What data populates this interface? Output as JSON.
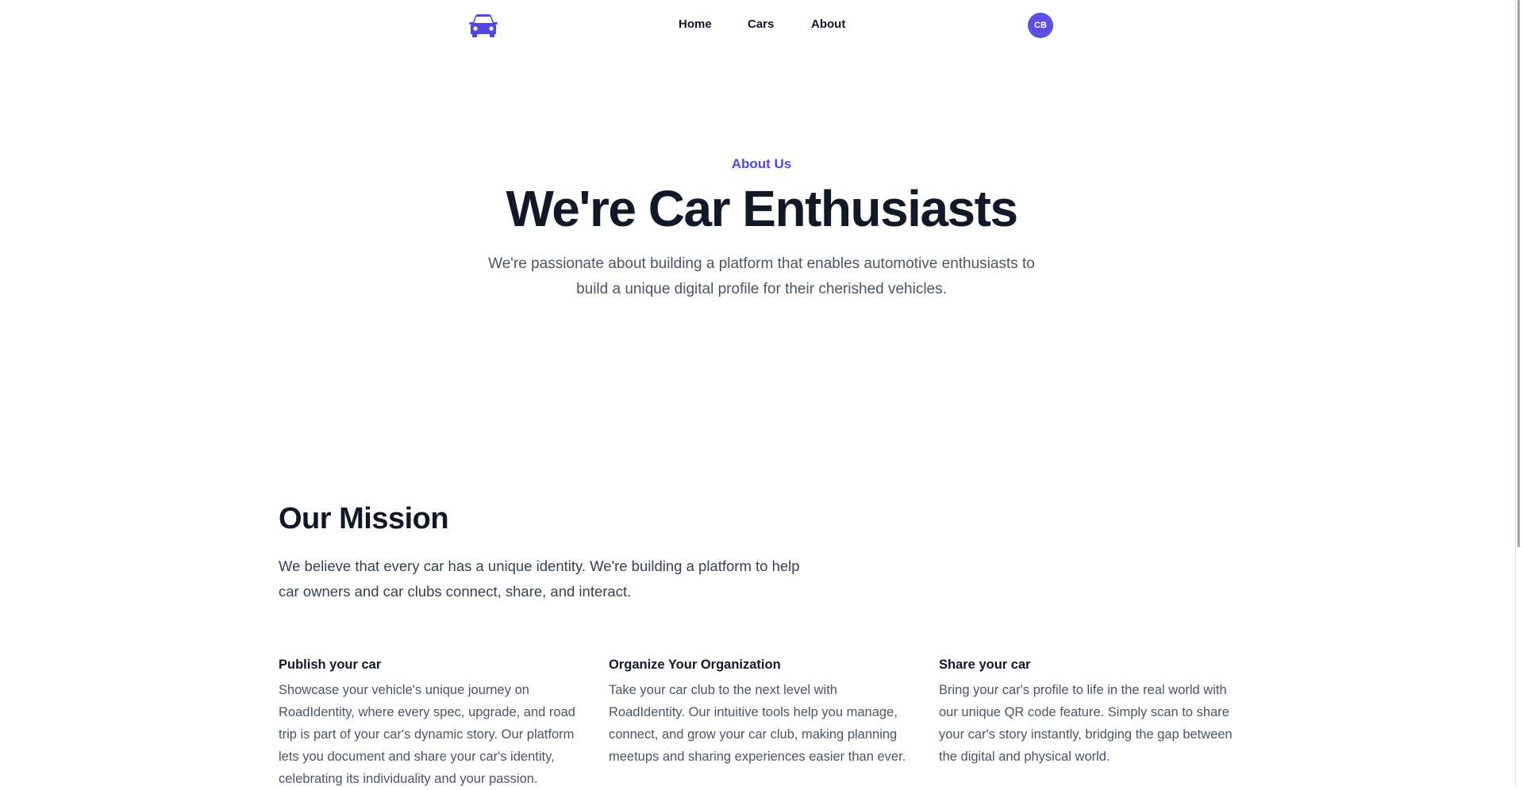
{
  "header": {
    "logo_icon": "car-icon",
    "nav": {
      "home": "Home",
      "cars": "Cars",
      "about": "About"
    },
    "avatar_initials": "CB"
  },
  "hero": {
    "eyebrow": "About Us",
    "title": "We're Car Enthusiasts",
    "subtitle": "We're passionate about building a platform that enables automotive enthusiasts to build a unique digital profile for their cherished vehicles."
  },
  "mission": {
    "title": "Our Mission",
    "text": "We believe that every car has a unique identity. We're building a platform to help car owners and car clubs connect, share, and interact."
  },
  "features": [
    {
      "title": "Publish your car",
      "text": "Showcase your vehicle's unique journey on RoadIdentity, where every spec, upgrade, and road trip is part of your car's dynamic story. Our platform lets you document and share your car's identity, celebrating its individuality and your passion."
    },
    {
      "title": "Organize Your Organization",
      "text": "Take your car club to the next level with RoadIdentity. Our intuitive tools help you manage, connect, and grow your car club, making planning meetups and sharing experiences easier than ever."
    },
    {
      "title": "Share your car",
      "text": "Bring your car's profile to life in the real world with our unique QR code feature. Simply scan to share your car's story instantly, bridging the gap between the digital and physical world."
    }
  ],
  "colors": {
    "accent": "#4f46e5",
    "avatar_bg": "#5b4fe8",
    "heading": "#111827",
    "body_text": "#4b5563"
  }
}
